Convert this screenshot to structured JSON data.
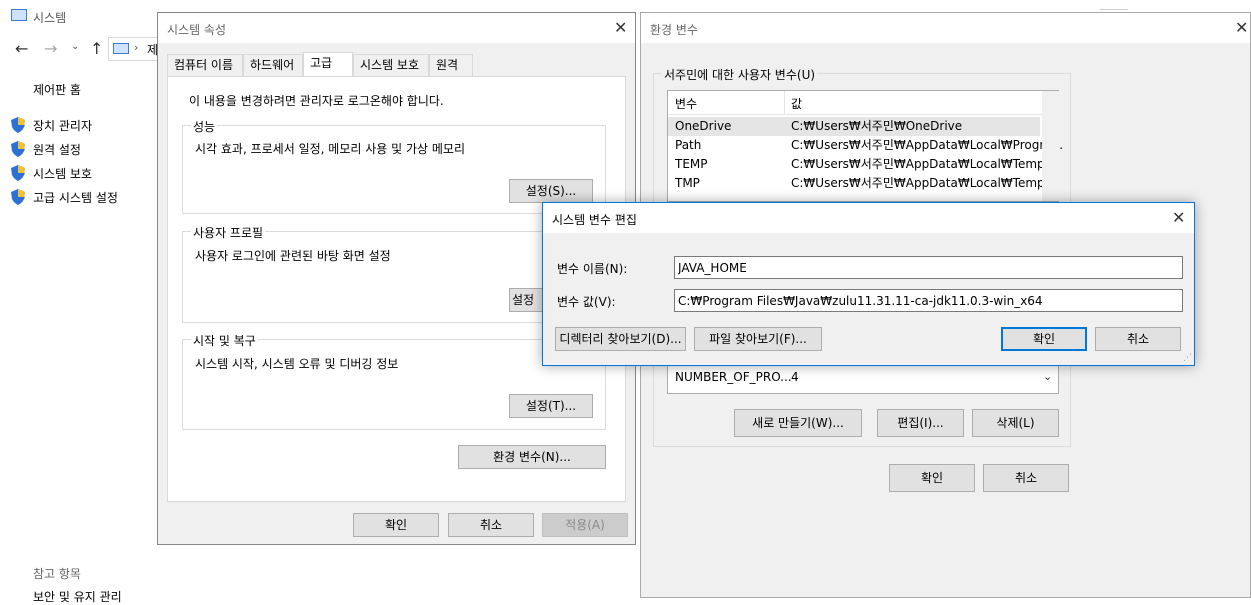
{
  "background_window": {
    "title": "시스템",
    "address_fragment": "제",
    "control_panel_home": "제어판 홈",
    "nav_links": [
      "장치 관리자",
      "원격 설정",
      "시스템 보호",
      "고급 시스템 설정"
    ],
    "see_also_label": "참고 항목",
    "see_also_links": [
      "보안 및 유지 관리"
    ]
  },
  "sys_props": {
    "title": "시스템 속성",
    "tabs": [
      "컴퓨터 이름",
      "하드웨어",
      "고급",
      "시스템 보호",
      "원격"
    ],
    "active_tab": "고급",
    "admin_note": "이 내용을 변경하려면 관리자로 로그온해야 합니다.",
    "perf_label": "성능",
    "perf_desc": "시각 효과, 프로세서 일정, 메모리 사용 및 가상 메모리",
    "perf_button": "설정(S)...",
    "profile_label": "사용자 프로필",
    "profile_desc": "사용자 로그인에 관련된 바탕 화면 설정",
    "profile_button": "설정",
    "startup_label": "시작 및 복구",
    "startup_desc": "시스템 시작, 시스템 오류 및 디버깅 정보",
    "startup_button": "설정(T)...",
    "env_button": "환경 변수(N)...",
    "ok": "확인",
    "cancel": "취소",
    "apply": "적용(A)"
  },
  "env_vars": {
    "title": "환경 변수",
    "user_group_label": "서주민에 대한 사용자 변수(U)",
    "col_var": "변수",
    "col_val": "값",
    "user_rows": [
      {
        "name": "OneDrive",
        "value": "C:₩Users₩서주민₩OneDrive"
      },
      {
        "name": "Path",
        "value": "C:₩Users₩서주민₩AppData₩Local₩Progra..."
      },
      {
        "name": "TEMP",
        "value": "C:₩Users₩서주민₩AppData₩Local₩Temp"
      },
      {
        "name": "TMP",
        "value": "C:₩Users₩서주민₩AppData₩Local₩Temp"
      }
    ],
    "system_partial_row": {
      "name": "NUMBER_OF_PRO...",
      "value": "4"
    },
    "new_button": "새로 만들기(W)...",
    "edit_button": "편집(I)...",
    "delete_button": "삭제(L)",
    "ok": "확인",
    "cancel": "취소"
  },
  "edit_dialog": {
    "title": "시스템 변수 편집",
    "name_label": "변수 이름(N):",
    "name_value": "JAVA_HOME",
    "value_label": "변수 값(V):",
    "value_value": "C:₩Program Files₩Java₩zulu11.31.11-ca-jdk11.0.3-win_x64",
    "browse_dir": "디렉터리 찾아보기(D)...",
    "browse_file": "파일 찾아보기(F)...",
    "ok": "확인",
    "cancel": "취소"
  },
  "colors": {
    "accent": "#0078d7",
    "selected_row": "#e5e5e5",
    "dialog_bg": "#f0f0f0"
  }
}
